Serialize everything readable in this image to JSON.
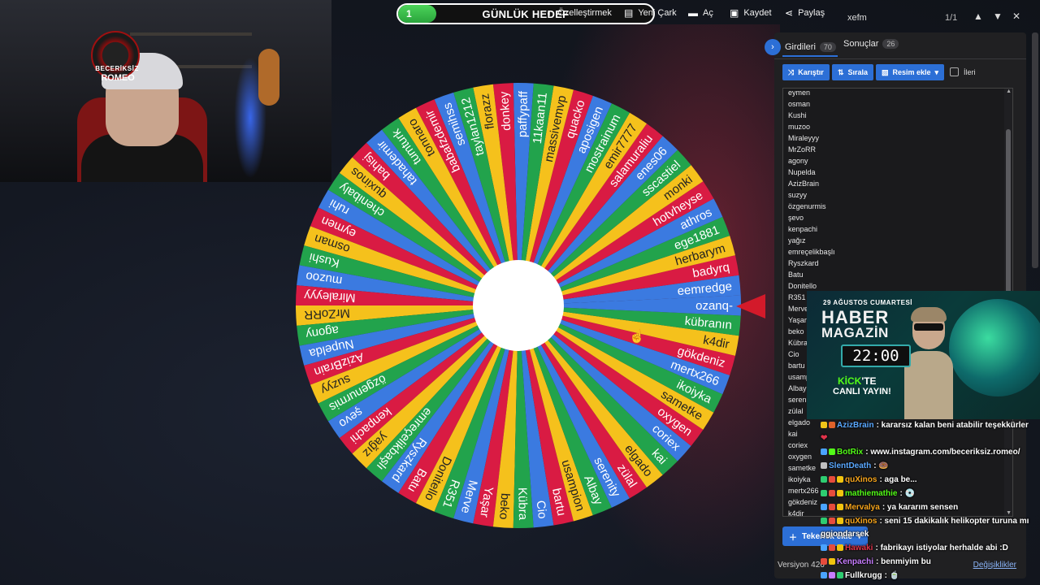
{
  "topbar": {
    "progress_value": "1",
    "progress_title": "GÜNLÜK HEDEF",
    "progress_fraction": 0.15,
    "items": [
      {
        "label": "Özelleştirmek",
        "icon": "palette-icon"
      },
      {
        "label": "Yeni Çark",
        "icon": "file-icon"
      },
      {
        "label": "Aç",
        "icon": "folder-icon"
      },
      {
        "label": "Kaydet",
        "icon": "save-icon"
      },
      {
        "label": "Paylaş",
        "icon": "share-icon"
      }
    ]
  },
  "findbar": {
    "query": "xefm",
    "count": "1/1",
    "prev": "▲",
    "next": "▼",
    "close": "✕"
  },
  "webcam": {
    "logo_top": "BECERİKSİZ",
    "logo_bottom": "ROMEO"
  },
  "wheel": {
    "colors": [
      "#3b7ae0",
      "#d91b43",
      "#f5c11c",
      "#22a34c"
    ],
    "pointer_color": "#d31a2a",
    "segments": [
      "eemredge",
      "badyrq",
      "herbarym",
      "ege1881",
      "athros",
      "hotvheyse",
      "monki",
      "sscastiel",
      "enes06",
      "salamuraliu",
      "emir7777",
      "mostrainum",
      "aposigen",
      "quacko",
      "massivemvp",
      "11kaan11",
      "paffypaff",
      "donkey",
      "florazz",
      "taylan1212",
      "semihss",
      "babafzdemir",
      "tonnaro",
      "tumturk",
      "tahademir",
      "bahisj",
      "quxinos",
      "chenibaly",
      "ruhi",
      "eymen",
      "osman",
      "Kushi",
      "muzoo",
      "Miraleyyy",
      "MrZoRR",
      "agony",
      "Nupelda",
      "AzizBrain",
      "suzyy",
      "özgenurmis",
      "şevo",
      "kenpachi",
      "yağız",
      "emreçelikbaşlı",
      "Ryszkard",
      "Batu",
      "Donitello",
      "R351",
      "Merve",
      "Yaşar",
      "beko",
      "Kübra",
      "Cio",
      "bartu",
      "usampion",
      "Albay",
      "serenity",
      "zülal",
      "elgado",
      "kai",
      "coriex",
      "oxygen",
      "sametke",
      "ikoiyka",
      "mertx266",
      "gökdeniz",
      "k4dir",
      "kübranın",
      "ozanq-"
    ]
  },
  "panel": {
    "tab_entries_label": "Girdileri",
    "tab_entries_count": "70",
    "tab_results_label": "Sonuçlar",
    "tab_results_count": "26",
    "shuffle_label": "Karıştır",
    "sort_label": "Sırala",
    "add_image_label": "Resim ekle",
    "advanced_label": "İleri",
    "entries": [
      "eymen",
      "osman",
      "Kushi",
      "muzoo",
      "Miraleyyy",
      "MrZoRR",
      "agony",
      "Nupelda",
      "AzizBrain",
      "suzyy",
      "özgenurmis",
      "şevo",
      "kenpachi",
      "yağız",
      "emreçelikbaşlı",
      "Ryszkard",
      "Batu",
      "Donitello",
      "R351",
      "Merve",
      "Yaşar",
      "beko",
      "Kübra",
      "Cio",
      "bartu",
      "usampion",
      "Albay",
      "serenity",
      "zülal",
      "elgado",
      "kai",
      "coriex",
      "oxygen",
      "sametke",
      "ikoiyka",
      "mertx266",
      "gökdeniz",
      "k4dir"
    ],
    "add_wheel_label": "Tekerlek ekle",
    "version": "Versiyon 426",
    "changes": "Değişiklikler"
  },
  "ad": {
    "date": "29 AĞUSTOS CUMARTESİ",
    "title1": "HABER",
    "title2": "MAGAZİN",
    "time": "22:00",
    "kick_prefix": "KİCK",
    "kick_suffix": "'TE",
    "live": "CANLI YAYIN!"
  },
  "chat": [
    {
      "user": "AzizBrain",
      "color": "#5aa8ff",
      "text": ": kararsız kalan beni atabilir teşekkürler",
      "badges": [
        "#f0c419",
        "#e0622a"
      ]
    },
    {
      "user": "",
      "color": "#e0334a",
      "text": "❤",
      "badges": []
    },
    {
      "user": "BotRix",
      "color": "#53fc18",
      "text": ": www.instagram.com/beceriksiz.romeo/",
      "badges": [
        "#4aa3ff",
        "#53fc18"
      ]
    },
    {
      "user": "SlentDeath",
      "color": "#5aa8ff",
      "text": ": 🍩",
      "badges": [
        "#c0c0c0"
      ]
    },
    {
      "user": "quXinos",
      "color": "#f7a51c",
      "text": ": aga be...",
      "badges": [
        "#2ecc71",
        "#e74c3c",
        "#f1c40f"
      ]
    },
    {
      "user": "mathiemathie",
      "color": "#53fc18",
      "text": ": 💿",
      "badges": [
        "#2ecc71",
        "#e74c3c",
        "#f1c40f"
      ]
    },
    {
      "user": "Mervalya",
      "color": "#f7a51c",
      "text": ": ya kararım sensen",
      "badges": [
        "#4aa3ff",
        "#e74c3c",
        "#f1c40f"
      ]
    },
    {
      "user": "quXinos",
      "color": "#f7a51c",
      "text": ": seni 15 dakikalık helikopter turuna mı",
      "badges": [
        "#2ecc71",
        "#e74c3c",
        "#f1c40f"
      ]
    },
    {
      "user": "ggiondarsek",
      "color": "#ffffff",
      "text": "",
      "badges": []
    },
    {
      "user": "Hawaki",
      "color": "#e0334a",
      "text": ": fabrikayı istiyolar herhalde abi :D",
      "badges": [
        "#4aa3ff",
        "#e74c3c",
        "#f1c40f"
      ]
    },
    {
      "user": "Kenpachi",
      "color": "#c77dff",
      "text": ": benmiyim bu",
      "badges": [
        "#e74c3c",
        "#f1c40f"
      ]
    },
    {
      "user": "Fullkrugg",
      "color": "#ffffff",
      "text": ": 🍵",
      "badges": [
        "#4aa3ff",
        "#c77dff",
        "#2ecc71"
      ]
    }
  ]
}
